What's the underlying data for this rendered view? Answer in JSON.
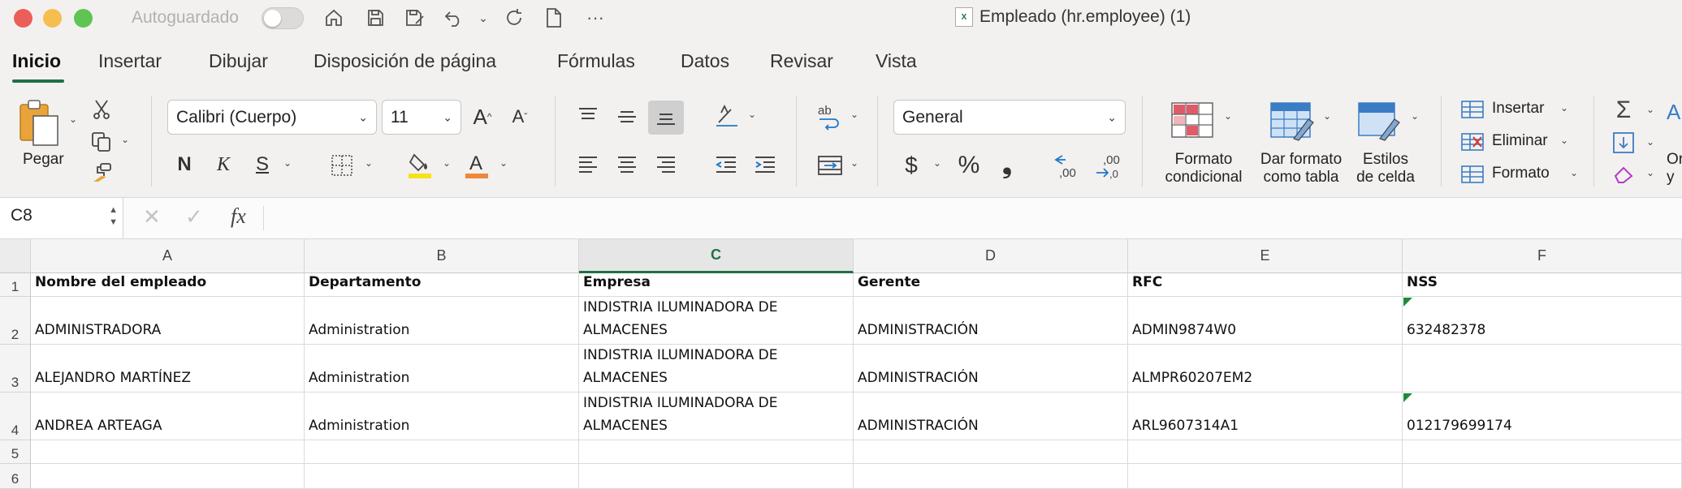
{
  "titlebar": {
    "autosave_label": "Autoguardado",
    "document_title": "Empleado (hr.employee) (1)",
    "file_icon_letter": "X",
    "icons": [
      "home-icon",
      "save-icon",
      "save-as-icon",
      "undo-icon",
      "redo-icon",
      "new-file-icon",
      "more-icon"
    ]
  },
  "tabs": [
    "Inicio",
    "Insertar",
    "Dibujar",
    "Disposición de página",
    "Fórmulas",
    "Datos",
    "Revisar",
    "Vista"
  ],
  "ribbon": {
    "paste_label": "Pegar",
    "font_name": "Calibri (Cuerpo)",
    "font_size": "11",
    "bold": "N",
    "italic": "K",
    "underline": "S",
    "number_format": "General",
    "currency": "$",
    "percent": "%",
    "thousands": "❟",
    "cond_format_label_1": "Formato",
    "cond_format_label_2": "condicional",
    "table_format_label_1": "Dar formato",
    "table_format_label_2": "como tabla",
    "cell_styles_label_1": "Estilos",
    "cell_styles_label_2": "de celda",
    "insert_label": "Insertar",
    "delete_label": "Eliminar",
    "format_label": "Formato",
    "sort_label_1": "Or",
    "sort_label_2": "y",
    "sum_icon": "Σ"
  },
  "formula_bar": {
    "name_box": "C8",
    "fx": "fx",
    "content": ""
  },
  "sheet": {
    "columns": [
      "A",
      "B",
      "C",
      "D",
      "E",
      "F"
    ],
    "selected_column": "C",
    "row_numbers": [
      "1",
      "2",
      "3",
      "4",
      "5",
      "6"
    ],
    "header_row": [
      "Nombre del empleado",
      "Departamento",
      "Empresa",
      "Gerente",
      "RFC",
      "NSS"
    ],
    "rows": [
      [
        "ADMINISTRADORA",
        "Administration",
        "INDISTRIA ILUMINADORA DE\nALMACENES",
        "ADMINISTRACIÓN",
        "ADMIN9874W0",
        "632482378"
      ],
      [
        "ALEJANDRO MARTÍNEZ",
        "Administration",
        "INDISTRIA ILUMINADORA DE\nALMACENES",
        "ADMINISTRACIÓN",
        "ALMPR60207EM2",
        ""
      ],
      [
        "ANDREA ARTEAGA",
        "Administration",
        "INDISTRIA ILUMINADORA DE\nALMACENES",
        "ADMINISTRACIÓN",
        "ARL9607314A1",
        "012179699174"
      ]
    ]
  },
  "colors": {
    "accent": "#1e7145",
    "highlight_yellow": "#f7e11b",
    "font_color_orange": "#f0883a"
  }
}
